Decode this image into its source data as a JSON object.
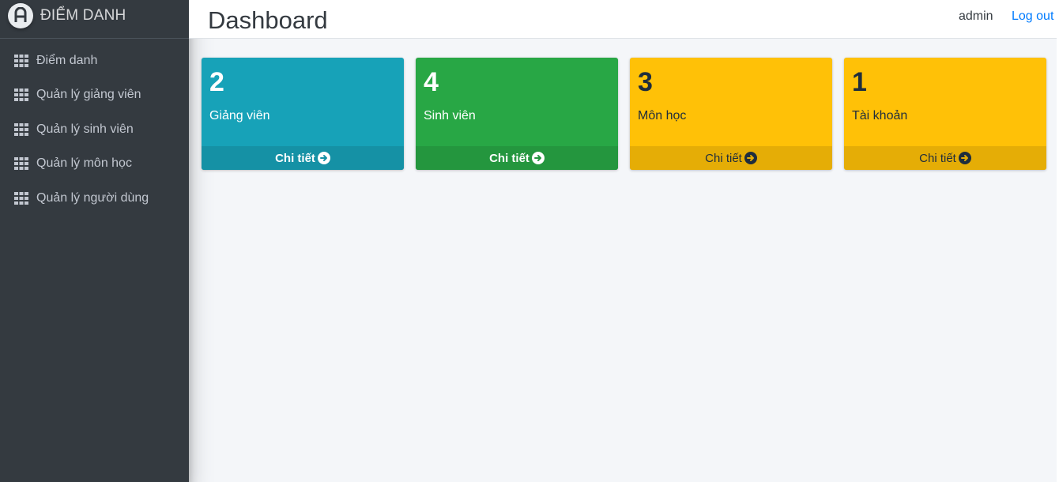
{
  "brand": {
    "logo_icon": "brand-logo-icon",
    "name": "ĐIỂM DANH"
  },
  "sidebar": {
    "items": [
      {
        "label": "Điểm danh",
        "icon": "grid-icon"
      },
      {
        "label": "Quản lý giảng viên",
        "icon": "grid-icon"
      },
      {
        "label": "Quản lý sinh viên",
        "icon": "grid-icon"
      },
      {
        "label": "Quản lý môn học",
        "icon": "grid-icon"
      },
      {
        "label": "Quản lý người dùng",
        "icon": "grid-icon"
      }
    ]
  },
  "header": {
    "title": "Dashboard",
    "user": "admin",
    "logout": "Log out"
  },
  "cards": [
    {
      "count": "2",
      "label": "Giảng viên",
      "link": "Chi tiết",
      "color": "#17a2b8"
    },
    {
      "count": "4",
      "label": "Sinh viên",
      "link": "Chi tiết",
      "color": "#28a745"
    },
    {
      "count": "3",
      "label": "Môn học",
      "link": "Chi tiết",
      "color": "#ffc107"
    },
    {
      "count": "1",
      "label": "Tài khoản",
      "link": "Chi tiết",
      "color": "#ffc107"
    }
  ],
  "colors": {
    "sidebar_bg": "#343a40",
    "content_bg": "#f4f6f9",
    "link": "#007bff"
  }
}
